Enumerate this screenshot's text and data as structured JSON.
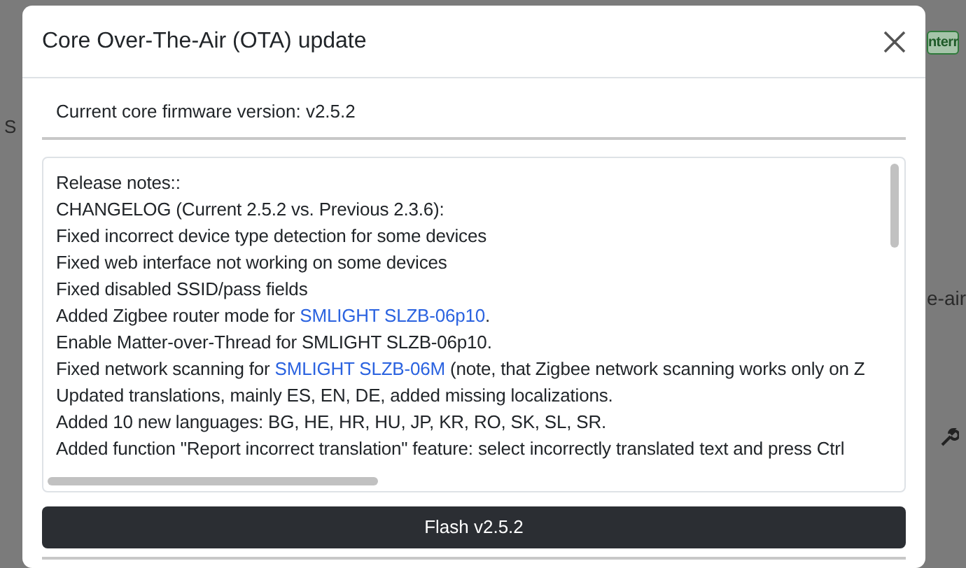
{
  "background": {
    "badge": "nterr",
    "left_text": "S",
    "right_text": "e-air"
  },
  "dialog": {
    "title": "Core Over-The-Air (OTA) update",
    "current_version": "Current core firmware version: v2.5.2",
    "release_notes": [
      [
        {
          "kind": "text",
          "text": "Release notes::"
        }
      ],
      [
        {
          "kind": "text",
          "text": "CHANGELOG (Current 2.5.2 vs. Previous 2.3.6):"
        }
      ],
      [
        {
          "kind": "text",
          "text": "Fixed incorrect device type detection for some devices"
        }
      ],
      [
        {
          "kind": "text",
          "text": "Fixed web interface not working on some devices"
        }
      ],
      [
        {
          "kind": "text",
          "text": "Fixed disabled SSID/pass fields"
        }
      ],
      [
        {
          "kind": "text",
          "text": "Added Zigbee router mode for "
        },
        {
          "kind": "link",
          "text": "SMLIGHT SLZB-06p10"
        },
        {
          "kind": "text",
          "text": "."
        }
      ],
      [
        {
          "kind": "text",
          "text": "Enable Matter-over-Thread for SMLIGHT SLZB-06p10."
        }
      ],
      [
        {
          "kind": "text",
          "text": "Fixed network scanning for "
        },
        {
          "kind": "link",
          "text": "SMLIGHT SLZB-06M"
        },
        {
          "kind": "text",
          "text": " (note, that Zigbee network scanning works only on Z"
        }
      ],
      [
        {
          "kind": "text",
          "text": "Updated translations, mainly ES, EN, DE, added missing localizations."
        }
      ],
      [
        {
          "kind": "text",
          "text": "Added 10 new languages: BG, HE, HR, HU, JP, KR, RO, SK, SL, SR."
        }
      ],
      [
        {
          "kind": "text",
          "text": "Added function \"Report incorrect translation\" feature: select incorrectly translated text and press Ctrl"
        }
      ]
    ],
    "flash_button": "Flash v2.5.2"
  }
}
